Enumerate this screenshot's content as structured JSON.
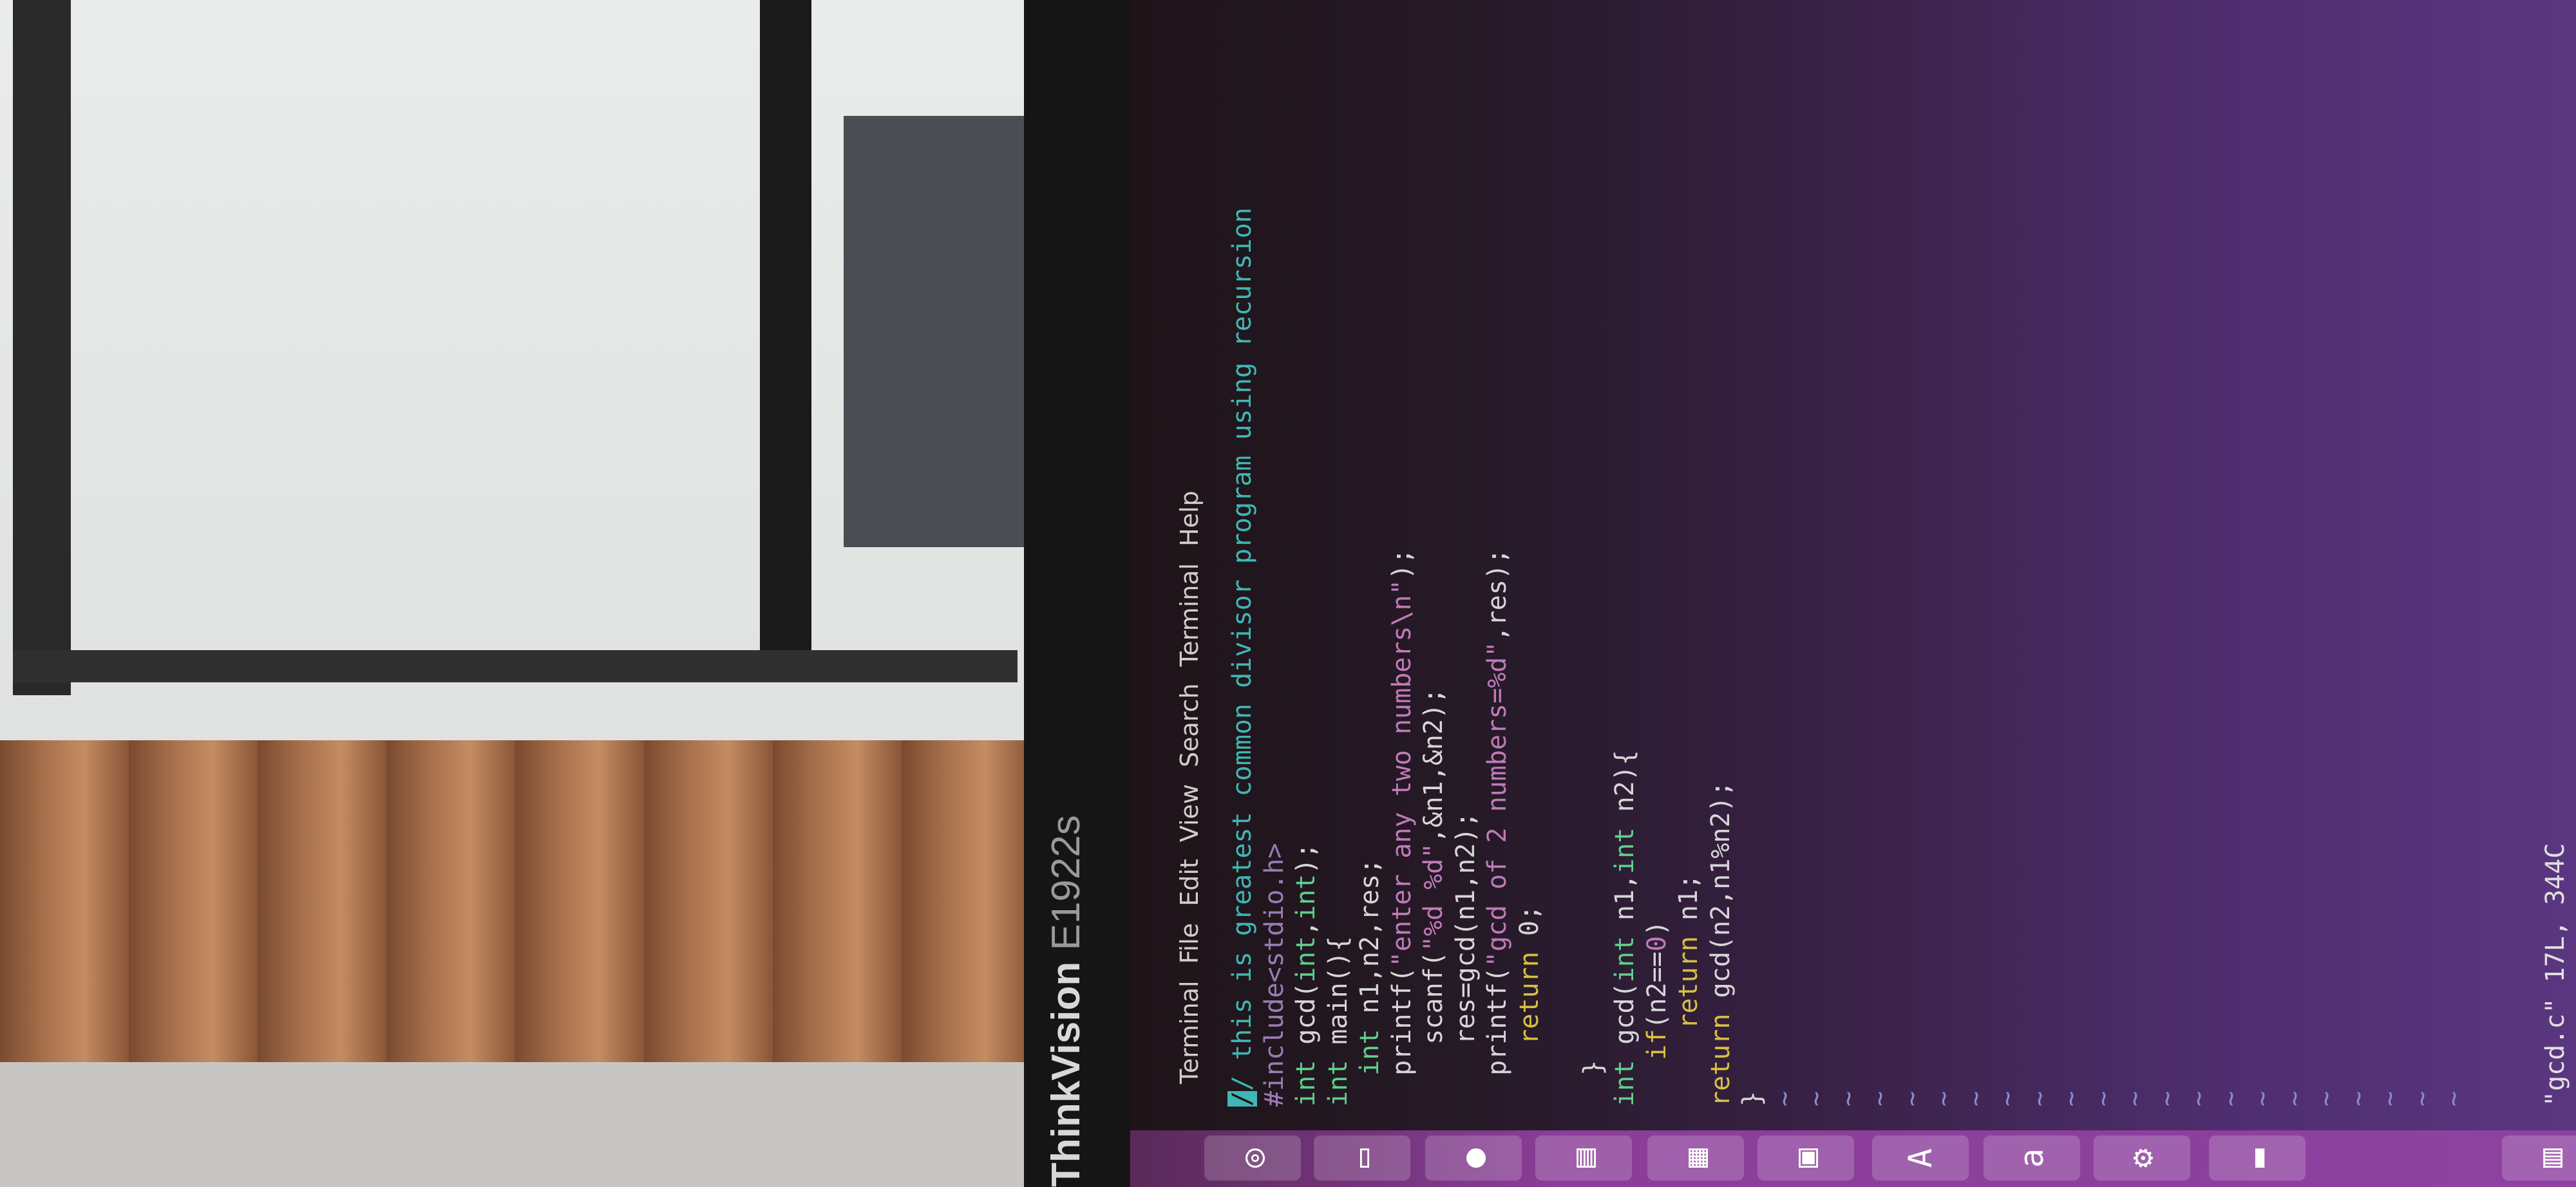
{
  "monitor": {
    "brand": "ThinkVision",
    "model": "E1922s"
  },
  "menu": [
    "Terminal",
    "File",
    "Edit",
    "View",
    "Search",
    "Terminal",
    "Help"
  ],
  "code_lines": [
    [
      [
        "/",
        "cur"
      ],
      [
        "/ this is greatest common divisor program using recursion",
        "cm"
      ]
    ],
    [
      [
        "#include<stdio.h>",
        "pp"
      ]
    ],
    [
      [
        "int",
        "ty"
      ],
      [
        " gcd(",
        "nm"
      ],
      [
        "int",
        "ty"
      ],
      [
        ",",
        "nm"
      ],
      [
        "int",
        "ty"
      ],
      [
        ");",
        "nm"
      ]
    ],
    [
      [
        "int",
        "ty"
      ],
      [
        " main(){",
        "nm"
      ]
    ],
    [
      [
        "  ",
        "nm"
      ],
      [
        "int",
        "ty"
      ],
      [
        " n1,n2,res;",
        "nm"
      ]
    ],
    [
      [
        "  printf(",
        "nm"
      ],
      [
        "\"enter any two numbers\\n\"",
        "st"
      ],
      [
        ");",
        "nm"
      ]
    ],
    [
      [
        "    scanf(",
        "nm"
      ],
      [
        "\"%d %d\"",
        "st"
      ],
      [
        ",&n1,&n2);",
        "nm"
      ]
    ],
    [
      [
        "    res=gcd(n1,n2);",
        "nm"
      ]
    ],
    [
      [
        "  printf(",
        "nm"
      ],
      [
        "\"gcd of 2 numbers=%d\"",
        "st"
      ],
      [
        ",res);",
        "nm"
      ]
    ],
    [
      [
        "    ",
        "nm"
      ],
      [
        "return",
        "kw"
      ],
      [
        " 0;",
        "nm"
      ]
    ],
    [
      [
        "",
        "nm"
      ]
    ],
    [
      [
        "  }",
        "nm"
      ]
    ],
    [
      [
        "int",
        "ty"
      ],
      [
        " gcd(",
        "nm"
      ],
      [
        "int",
        "ty"
      ],
      [
        " n1,",
        "nm"
      ],
      [
        "int",
        "ty"
      ],
      [
        " n2){",
        "nm"
      ]
    ],
    [
      [
        "   ",
        "nm"
      ],
      [
        "if",
        "kw"
      ],
      [
        "(n2==",
        "nm"
      ],
      [
        "0",
        "st"
      ],
      [
        ")",
        "nm"
      ]
    ],
    [
      [
        "     ",
        "nm"
      ],
      [
        "return",
        "kw"
      ],
      [
        " n1;",
        "nm"
      ]
    ],
    [
      [
        "return",
        "kw"
      ],
      [
        " gcd(n2,n1%n2);",
        "nm"
      ]
    ],
    [
      [
        "}",
        "nm"
      ]
    ]
  ],
  "empty_line_marker": "~",
  "status_line": "\"gcd.c\" 17L, 344C",
  "dock_icons": [
    "ubuntu-icon",
    "files-icon",
    "firefox-icon",
    "writer-icon",
    "calc-icon",
    "impress-icon",
    "software-center-icon",
    "amazon-icon",
    "settings-icon",
    "terminal-icon",
    "trash-icon"
  ],
  "colors": {
    "comment": "#3fb7b4",
    "type": "#5fd08a",
    "string": "#c07ab8",
    "keyword": "#d8c040",
    "dock": "#8e42a0"
  }
}
